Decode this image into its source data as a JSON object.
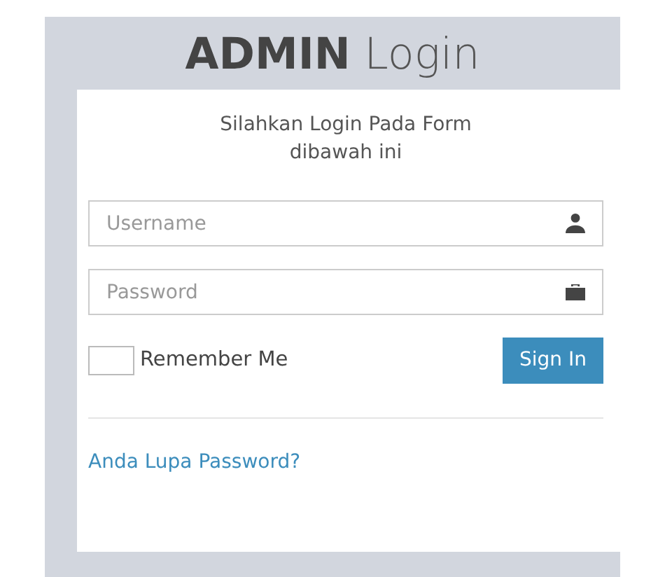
{
  "title": {
    "bold": "ADMIN",
    "light": "Login"
  },
  "subtitle": "Silahkan Login Pada Form dibawah ini",
  "fields": [
    {
      "kind": "user",
      "placeholder": "Username"
    },
    {
      "kind": "lock",
      "placeholder": "Password"
    }
  ],
  "remember": {
    "label": "Remember Me",
    "checked": false
  },
  "sign_in": "Sign In",
  "forgot_link": "Anda Lupa Password?"
}
